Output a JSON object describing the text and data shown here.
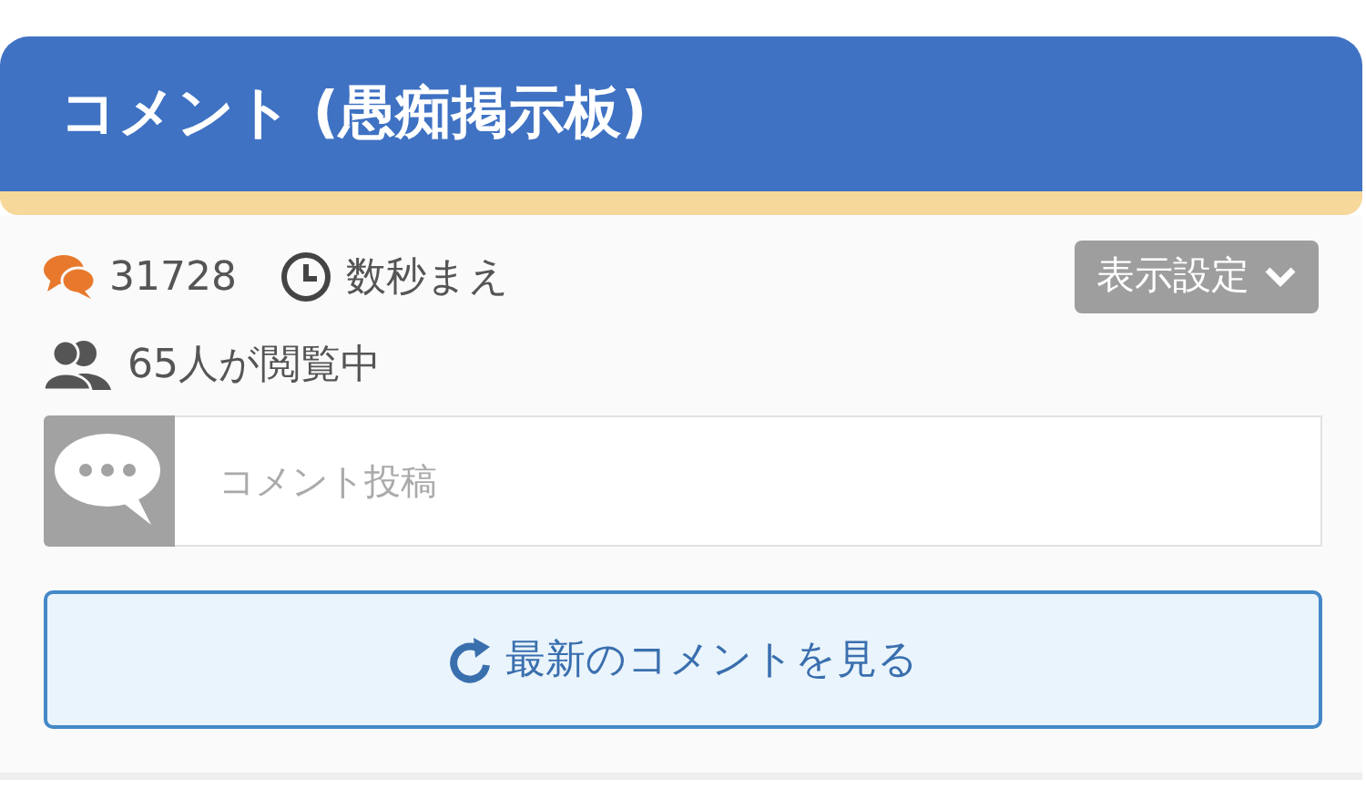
{
  "header": {
    "title": "コメント (愚痴掲示板)"
  },
  "stats": {
    "comment_count": "31728",
    "updated": "数秒まえ",
    "viewers": "65人が閲覧中"
  },
  "display_settings_button": "表示設定",
  "comment_input": {
    "placeholder": "コメント投稿"
  },
  "refresh_button": "最新のコメントを見る"
}
